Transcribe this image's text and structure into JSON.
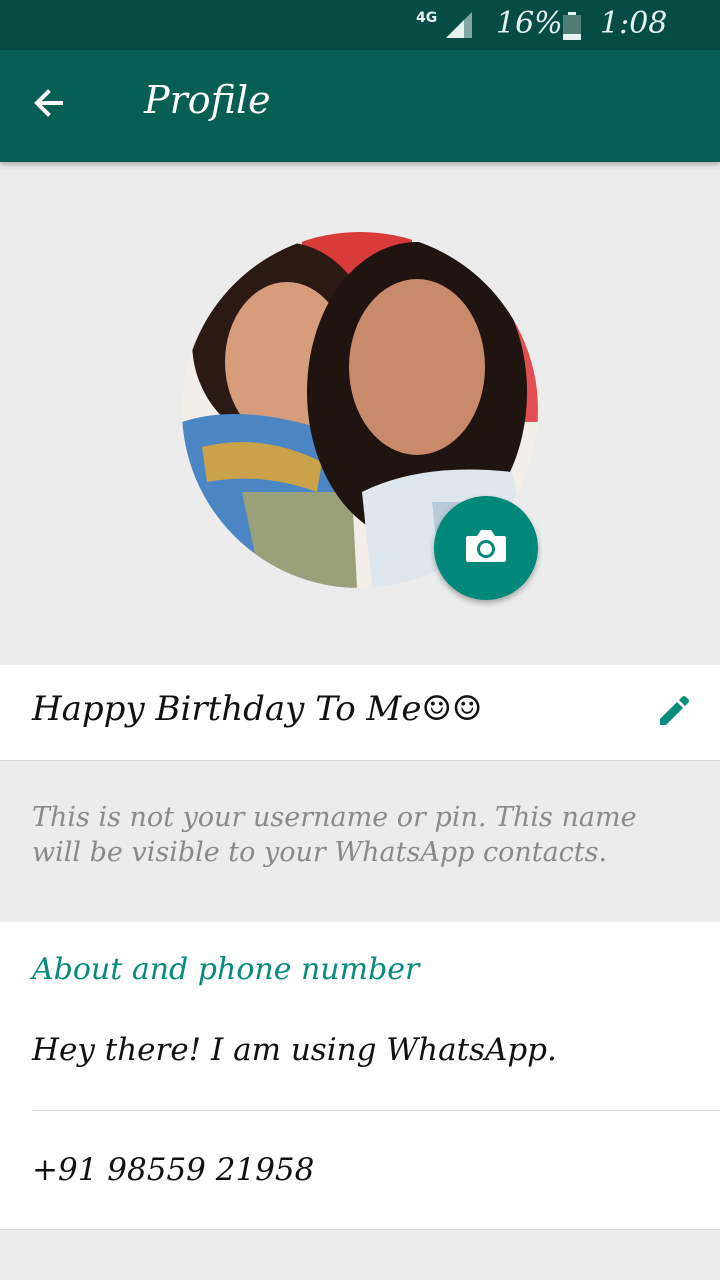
{
  "status_bar": {
    "network": "4G",
    "battery_percent": "16%",
    "time": "1:08 pm"
  },
  "app_bar": {
    "title": "Profile",
    "back_icon": "arrow-back-icon"
  },
  "profile": {
    "camera_icon": "camera-icon",
    "name": "Happy Birthday To Me☺☺",
    "edit_icon": "pencil-icon",
    "name_hint": "This is not your username or pin. This name will be visible to your WhatsApp contacts."
  },
  "about_section": {
    "title": "About and phone number",
    "about": "Hey there! I am using WhatsApp.",
    "phone": "+91 98559 21958"
  },
  "colors": {
    "status_bar": "#054d44",
    "app_bar": "#075e54",
    "accent": "#00897b",
    "section_title": "#078b7d"
  }
}
